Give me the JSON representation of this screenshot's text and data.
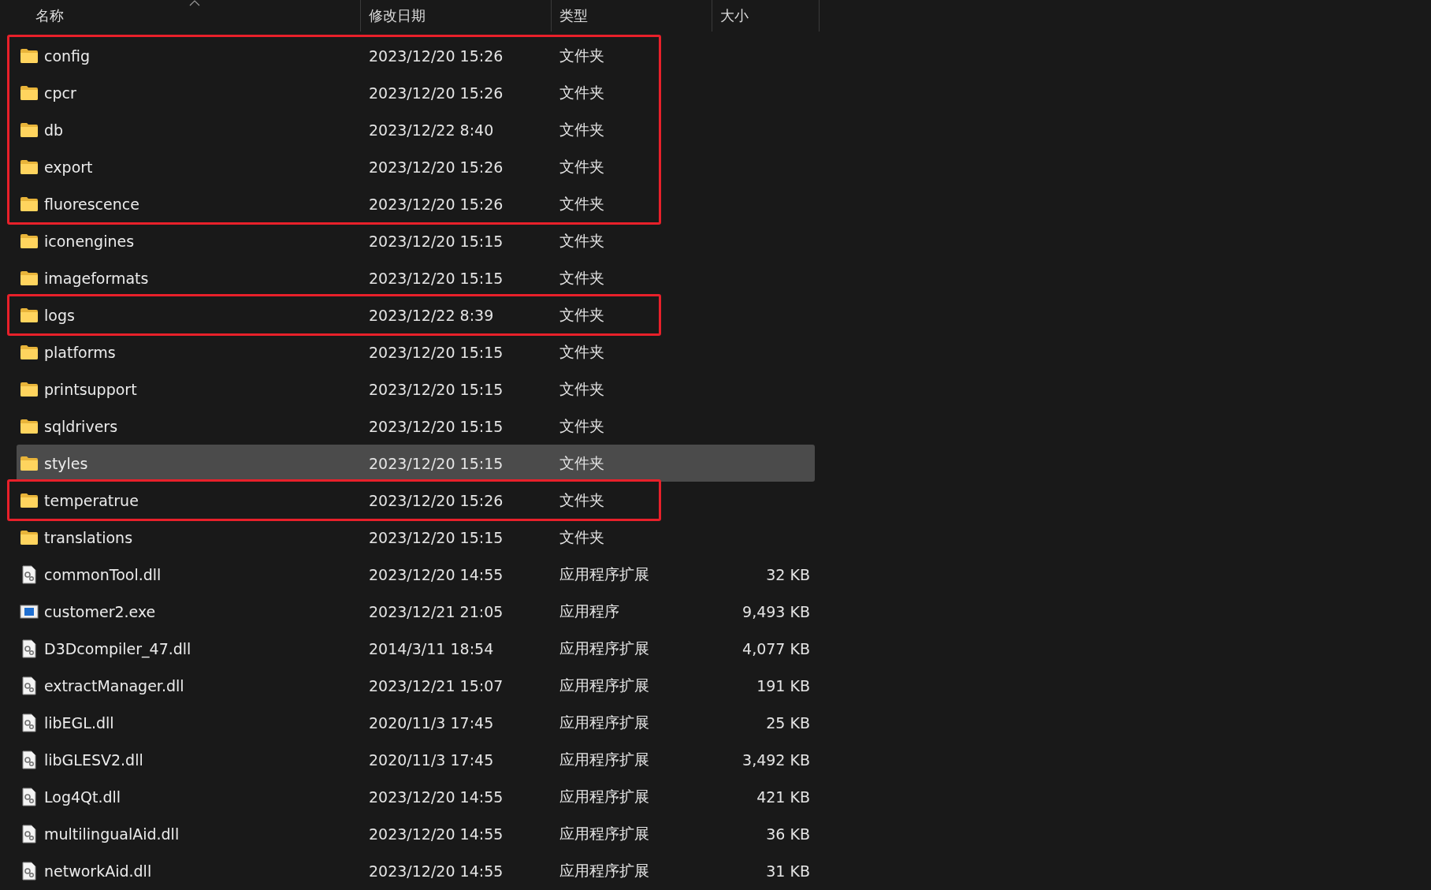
{
  "header": {
    "columns": [
      {
        "label": "名称",
        "sorted": true
      },
      {
        "label": "修改日期",
        "sorted": false
      },
      {
        "label": "类型",
        "sorted": false
      },
      {
        "label": "大小",
        "sorted": false
      }
    ]
  },
  "rows": [
    {
      "kind": "folder",
      "name": "config",
      "date": "2023/12/20 15:26",
      "type": "文件夹",
      "selected": false,
      "boxed": true
    },
    {
      "kind": "folder",
      "name": "cpcr",
      "date": "2023/12/20 15:26",
      "type": "文件夹",
      "selected": false,
      "boxed": true
    },
    {
      "kind": "folder",
      "name": "db",
      "date": "2023/12/22 8:40",
      "type": "文件夹",
      "selected": false,
      "boxed": true
    },
    {
      "kind": "folder",
      "name": "export",
      "date": "2023/12/20 15:26",
      "type": "文件夹",
      "selected": false,
      "boxed": true
    },
    {
      "kind": "folder",
      "name": "fluorescence",
      "date": "2023/12/20 15:26",
      "type": "文件夹",
      "selected": false,
      "boxed": true
    },
    {
      "kind": "folder",
      "name": "iconengines",
      "date": "2023/12/20 15:15",
      "type": "文件夹",
      "selected": false,
      "boxed": false
    },
    {
      "kind": "folder",
      "name": "imageformats",
      "date": "2023/12/20 15:15",
      "type": "文件夹",
      "selected": false,
      "boxed": false
    },
    {
      "kind": "folder",
      "name": "logs",
      "date": "2023/12/22 8:39",
      "type": "文件夹",
      "selected": false,
      "boxed": true
    },
    {
      "kind": "folder",
      "name": "platforms",
      "date": "2023/12/20 15:15",
      "type": "文件夹",
      "selected": false,
      "boxed": false
    },
    {
      "kind": "folder",
      "name": "printsupport",
      "date": "2023/12/20 15:15",
      "type": "文件夹",
      "selected": false,
      "boxed": false
    },
    {
      "kind": "folder",
      "name": "sqldrivers",
      "date": "2023/12/20 15:15",
      "type": "文件夹",
      "selected": false,
      "boxed": false
    },
    {
      "kind": "folder",
      "name": "styles",
      "date": "2023/12/20 15:15",
      "type": "文件夹",
      "selected": true,
      "boxed": false
    },
    {
      "kind": "folder",
      "name": "temperatrue",
      "date": "2023/12/20 15:26",
      "type": "文件夹",
      "selected": false,
      "boxed": true
    },
    {
      "kind": "folder",
      "name": "translations",
      "date": "2023/12/20 15:15",
      "type": "文件夹",
      "selected": false,
      "boxed": false
    },
    {
      "kind": "dll",
      "name": "commonTool.dll",
      "date": "2023/12/20 14:55",
      "type": "应用程序扩展",
      "size": "32 KB",
      "selected": false,
      "boxed": false
    },
    {
      "kind": "exe",
      "name": "customer2.exe",
      "date": "2023/12/21 21:05",
      "type": "应用程序",
      "size": "9,493 KB",
      "selected": false,
      "boxed": false
    },
    {
      "kind": "dll",
      "name": "D3Dcompiler_47.dll",
      "date": "2014/3/11 18:54",
      "type": "应用程序扩展",
      "size": "4,077 KB",
      "selected": false,
      "boxed": false
    },
    {
      "kind": "dll",
      "name": "extractManager.dll",
      "date": "2023/12/21 15:07",
      "type": "应用程序扩展",
      "size": "191 KB",
      "selected": false,
      "boxed": false
    },
    {
      "kind": "dll",
      "name": "libEGL.dll",
      "date": "2020/11/3 17:45",
      "type": "应用程序扩展",
      "size": "25 KB",
      "selected": false,
      "boxed": false
    },
    {
      "kind": "dll",
      "name": "libGLESV2.dll",
      "date": "2020/11/3 17:45",
      "type": "应用程序扩展",
      "size": "3,492 KB",
      "selected": false,
      "boxed": false
    },
    {
      "kind": "dll",
      "name": "Log4Qt.dll",
      "date": "2023/12/20 14:55",
      "type": "应用程序扩展",
      "size": "421 KB",
      "selected": false,
      "boxed": false
    },
    {
      "kind": "dll",
      "name": "multilingualAid.dll",
      "date": "2023/12/20 14:55",
      "type": "应用程序扩展",
      "size": "36 KB",
      "selected": false,
      "boxed": false
    },
    {
      "kind": "dll",
      "name": "networkAid.dll",
      "date": "2023/12/20 14:55",
      "type": "应用程序扩展",
      "size": "31 KB",
      "selected": false,
      "boxed": false
    }
  ]
}
